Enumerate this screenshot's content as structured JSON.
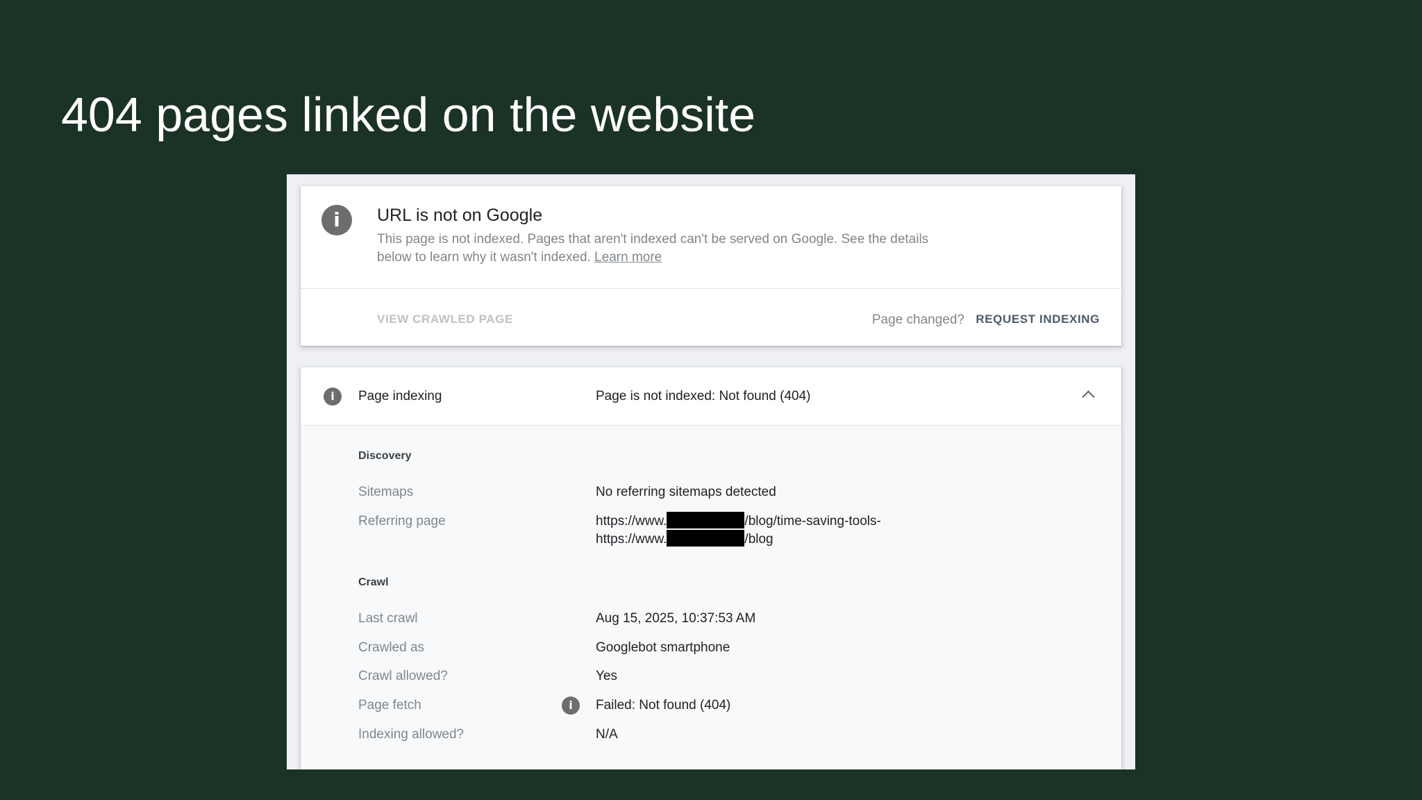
{
  "slide": {
    "title": "404 pages linked on the website"
  },
  "status_card": {
    "title": "URL is not on Google",
    "description": "This page is not indexed. Pages that aren't indexed can't be served on Google. See the details below to learn why it wasn't indexed.",
    "learn_more": "Learn more",
    "view_crawled_page": "VIEW CRAWLED PAGE",
    "page_changed": "Page changed?",
    "request_indexing": "REQUEST INDEXING",
    "info_glyph": "i"
  },
  "indexing": {
    "label": "Page indexing",
    "value": "Page is not indexed: Not found (404)",
    "info_glyph": "i",
    "discovery": {
      "title": "Discovery",
      "sitemaps_label": "Sitemaps",
      "sitemaps_value": "No referring sitemaps detected",
      "referring_label": "Referring page",
      "referring_pages": [
        {
          "prefix": "https://www.",
          "suffix": "/blog/time-saving-tools-"
        },
        {
          "prefix": "https://www.",
          "suffix": "/blog"
        }
      ]
    },
    "crawl": {
      "title": "Crawl",
      "rows": [
        {
          "label": "Last crawl",
          "value": "Aug 15, 2025, 10:37:53 AM"
        },
        {
          "label": "Crawled as",
          "value": "Googlebot smartphone"
        },
        {
          "label": "Crawl allowed?",
          "value": "Yes"
        },
        {
          "label": "Page fetch",
          "value": "Failed: Not found (404)"
        },
        {
          "label": "Indexing allowed?",
          "value": "N/A"
        }
      ]
    }
  },
  "colors": {
    "slide_background": "#1b3326",
    "icon_gray": "#6d6d6d",
    "muted_text": "#80868b",
    "primary_text": "#202124"
  }
}
